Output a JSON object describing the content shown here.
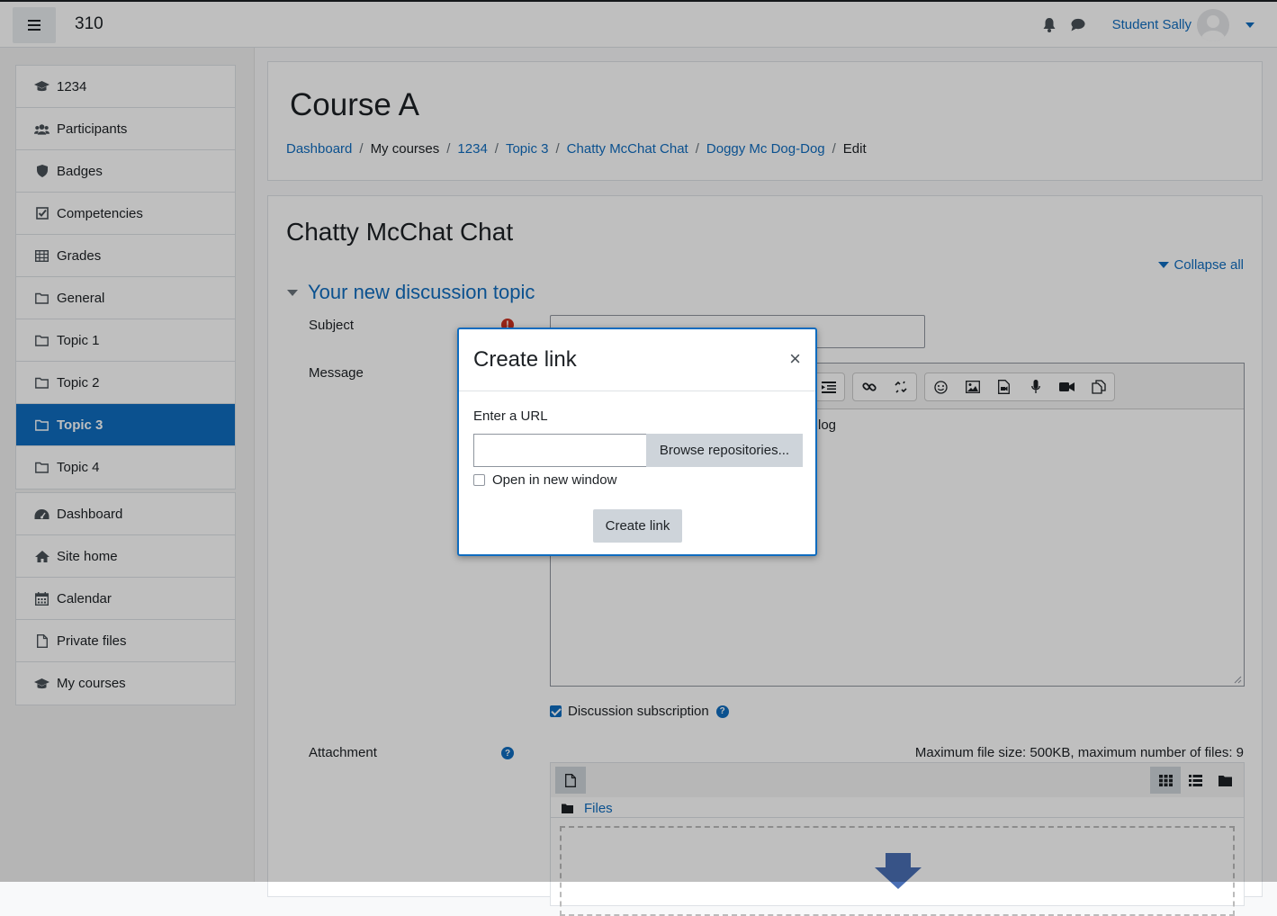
{
  "navbar": {
    "site_name": "310",
    "user_name": "Student Sally"
  },
  "drawer": {
    "course_items": [
      {
        "label": "1234",
        "icon": "graduation-cap-icon"
      },
      {
        "label": "Participants",
        "icon": "users-icon"
      },
      {
        "label": "Badges",
        "icon": "shield-icon"
      },
      {
        "label": "Competencies",
        "icon": "check-square-icon"
      },
      {
        "label": "Grades",
        "icon": "table-icon"
      },
      {
        "label": "General",
        "icon": "folder-icon"
      },
      {
        "label": "Topic 1",
        "icon": "folder-icon"
      },
      {
        "label": "Topic 2",
        "icon": "folder-icon"
      },
      {
        "label": "Topic 3",
        "icon": "folder-icon",
        "active": true
      },
      {
        "label": "Topic 4",
        "icon": "folder-icon"
      }
    ],
    "site_items": [
      {
        "label": "Dashboard",
        "icon": "dashboard-icon"
      },
      {
        "label": "Site home",
        "icon": "home-icon"
      },
      {
        "label": "Calendar",
        "icon": "calendar-icon"
      },
      {
        "label": "Private files",
        "icon": "file-icon"
      },
      {
        "label": "My courses",
        "icon": "graduation-cap-icon"
      }
    ]
  },
  "header": {
    "course_title": "Course A",
    "breadcrumb": [
      "Dashboard",
      "My courses",
      "1234",
      "Topic 3",
      "Chatty McChat Chat",
      "Doggy Mc Dog-Dog",
      "Edit"
    ]
  },
  "form": {
    "forum_title": "Chatty McChat Chat",
    "collapse_all": "Collapse all",
    "section_title": "Your new discussion topic",
    "subject_label": "Subject",
    "message_label": "Message",
    "editor_visible_text": "log",
    "subscription_label": "Discussion subscription",
    "attachment_label": "Attachment",
    "attachment_limits": "Maximum file size: 500KB, maximum number of files: 9",
    "files_label": "Files"
  },
  "dialog": {
    "title": "Create link",
    "close": "×",
    "url_label": "Enter a URL",
    "url_value": "",
    "browse_button": "Browse repositories...",
    "new_window_label": "Open in new window",
    "submit_button": "Create link"
  }
}
